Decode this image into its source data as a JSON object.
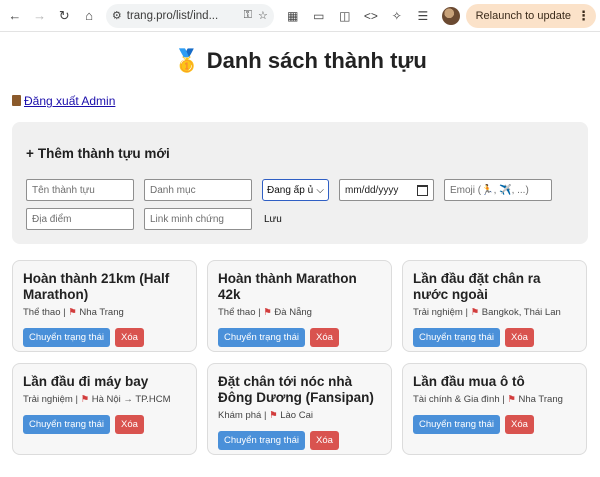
{
  "browser": {
    "url": "trang.pro/list/ind...",
    "relaunch_label": "Relaunch to update"
  },
  "page": {
    "title": "🥇 Danh sách thành tựu",
    "logout_label": "Đăng xuất Admin"
  },
  "form": {
    "heading": "Thêm thành tựu mới",
    "name_placeholder": "Tên thành tựu",
    "category_placeholder": "Danh mục",
    "status_value": "Đang ấp ủ",
    "date_placeholder": "mm/dd/yyyy",
    "emoji_placeholder": "Emoji (🏃, ✈️, ...)",
    "location_placeholder": "Địa điểm",
    "proof_placeholder": "Link minh chứng",
    "save_label": "Lưu"
  },
  "achievements": [
    {
      "title": "Hoàn thành 21km (Half Marathon)",
      "category": "Thể thao",
      "location": "Nha Trang"
    },
    {
      "title": "Hoàn thành Marathon 42k",
      "category": "Thể thao",
      "location": "Đà Nẵng"
    },
    {
      "title": "Lần đầu đặt chân ra nước ngoài",
      "category": "Trải nghiệm",
      "location": "Bangkok, Thái Lan"
    },
    {
      "title": "Lần đầu đi máy bay",
      "category": "Trải nghiệm",
      "location": "Hà Nội → TP.HCM"
    },
    {
      "title": "Đặt chân tới nóc nhà Đông Dương (Fansipan)",
      "category": "Khám phá",
      "location": "Lào Cai"
    },
    {
      "title": "Lần đầu mua ô tô",
      "category": "Tài chính & Gia đình",
      "location": "Nha Trang"
    }
  ],
  "card_actions": {
    "toggle_label": "Chuyển trạng thái",
    "delete_label": "Xóa"
  },
  "colors": {
    "toggle_button": "#4a90d9",
    "delete_button": "#d9534f",
    "relaunch_bg": "#fbe2c9"
  }
}
